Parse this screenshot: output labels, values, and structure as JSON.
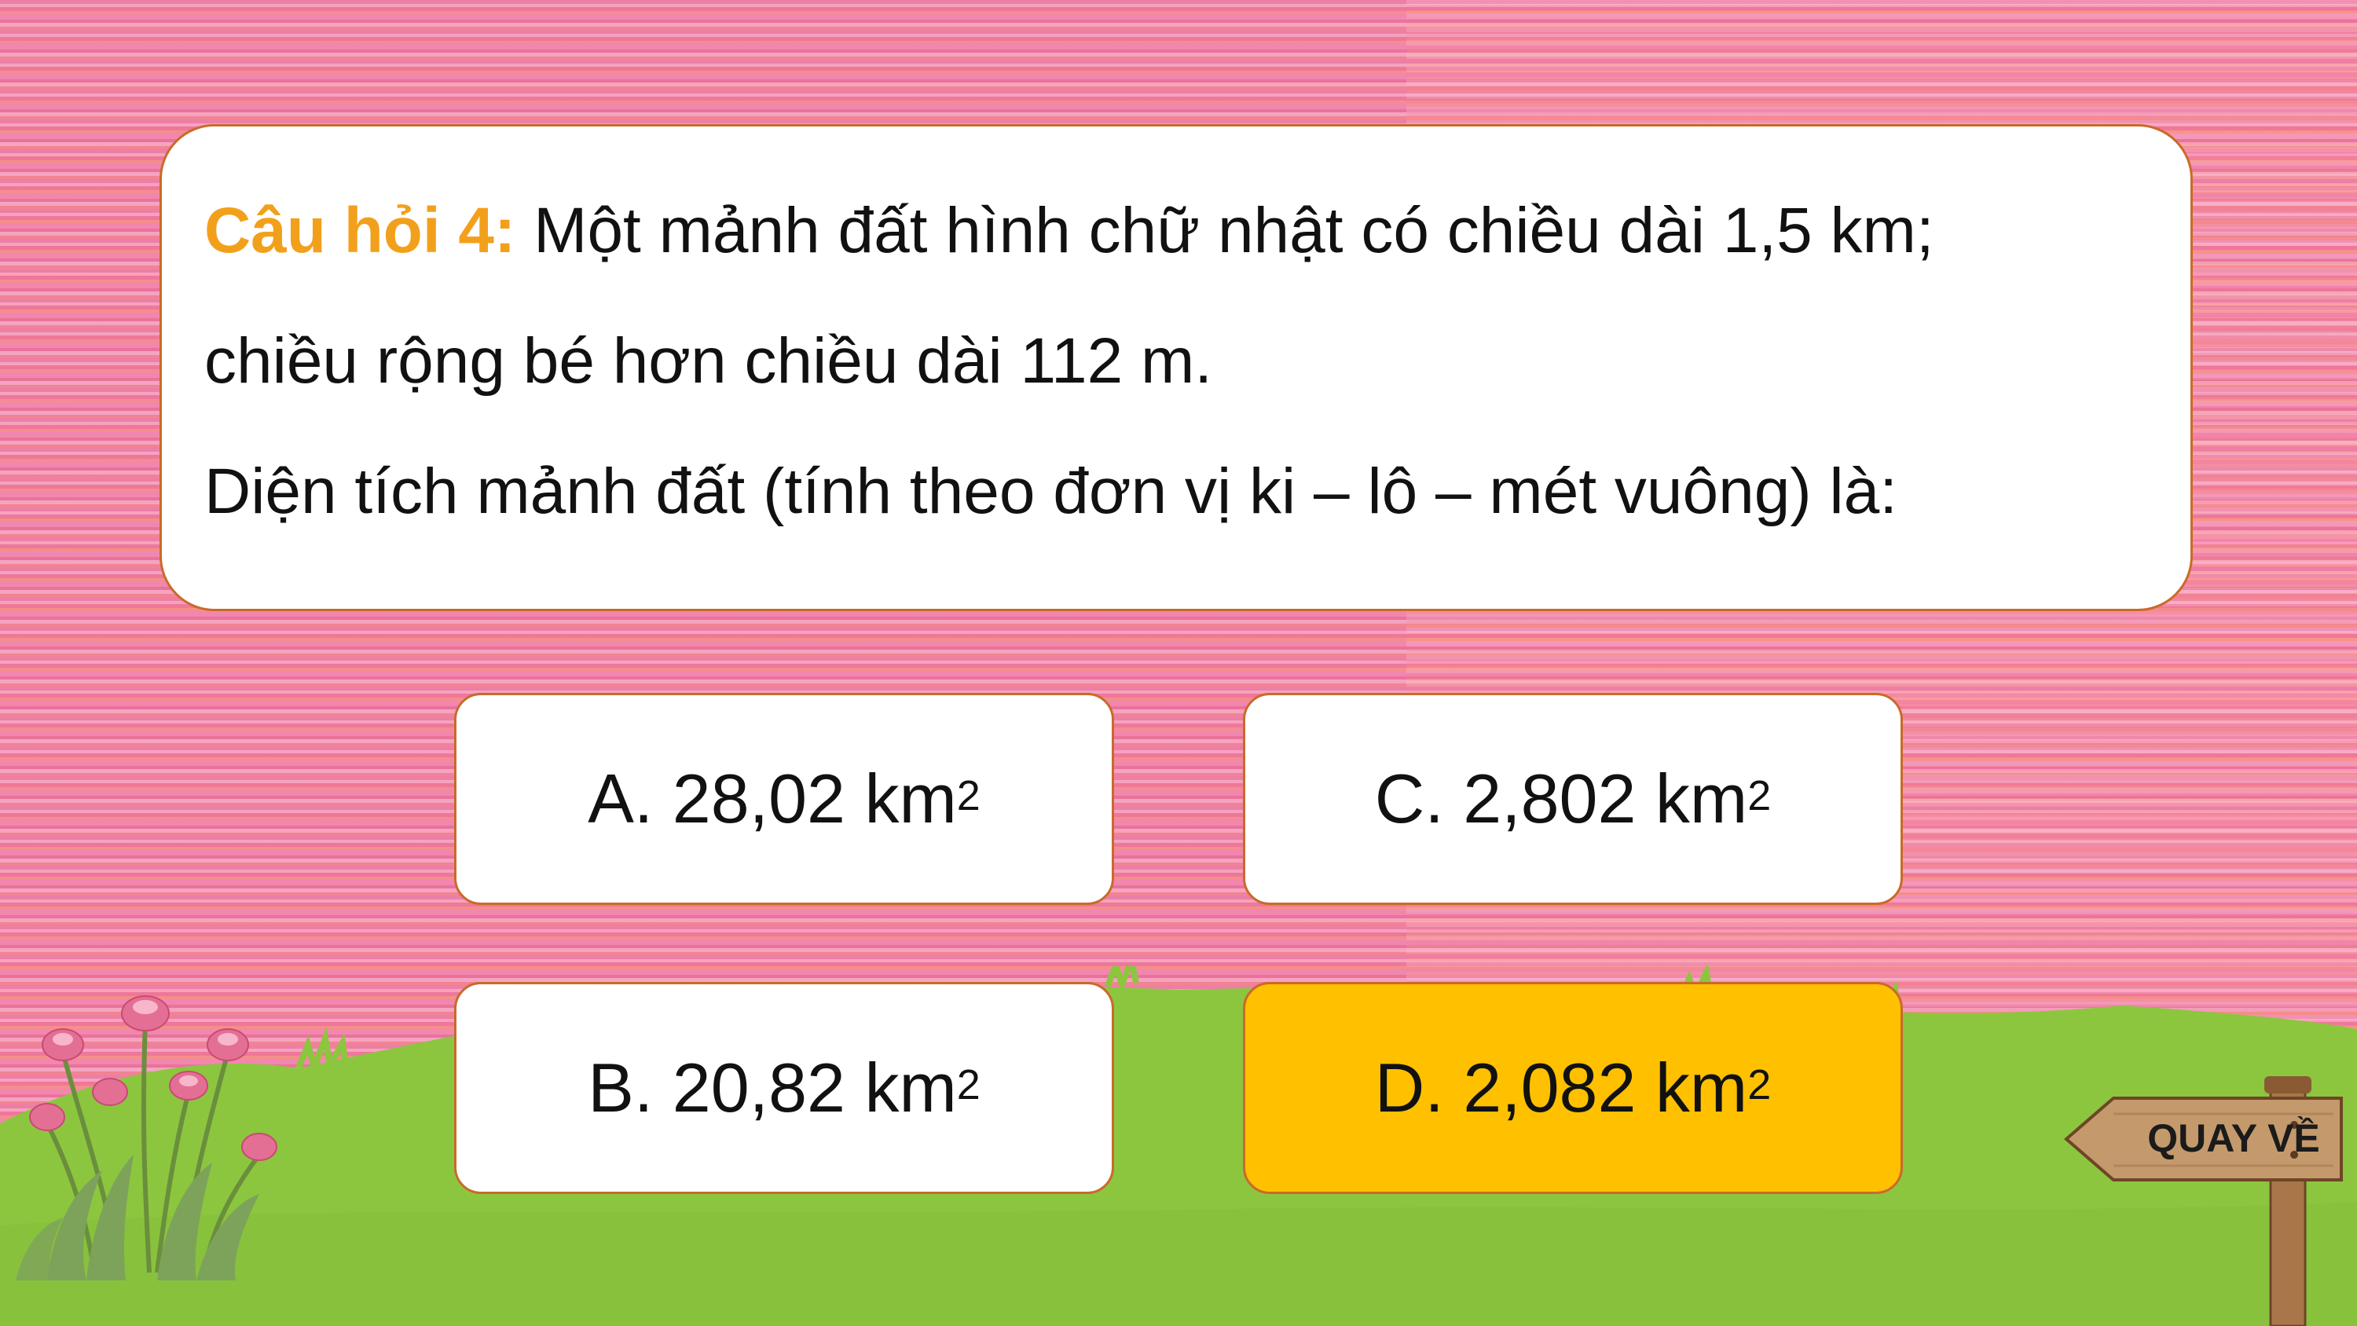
{
  "question": {
    "label": "Câu hỏi 4:",
    "line1": " Một mảnh đất hình chữ nhật có chiều dài 1,5 km;",
    "line2": "chiều rộng bé hơn chiều dài 112 m.",
    "line3": "Diện tích mảnh đất (tính theo đơn vị ki – lô – mét vuông) là:"
  },
  "answers": [
    {
      "text": "A. 28,02 km",
      "sup": "2",
      "correct": false
    },
    {
      "text": "C. 2,802 km",
      "sup": "2",
      "correct": false
    },
    {
      "text": "B. 20,82 km",
      "sup": "2",
      "correct": false
    },
    {
      "text": "D. 2,082 km",
      "sup": "2",
      "correct": true
    }
  ],
  "nav": {
    "back_label": "QUAY VỀ"
  },
  "colors": {
    "label": "#f2a01c",
    "correct_answer": "#ffc000",
    "border": "#c96a2a",
    "grass": "#8cc63f",
    "background": "#ec7fa6"
  }
}
